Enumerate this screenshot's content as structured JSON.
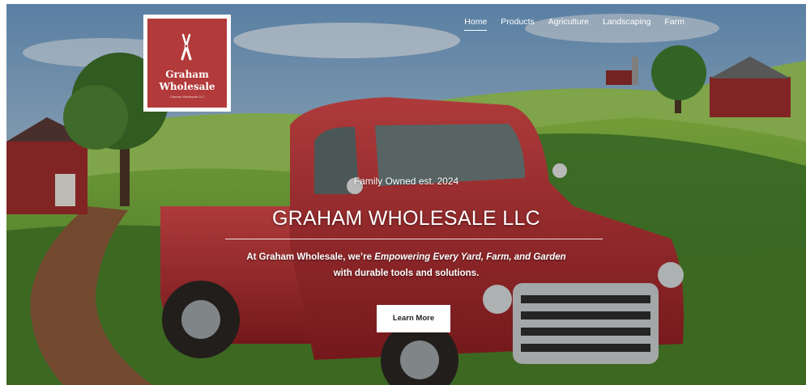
{
  "brand": {
    "name": "Graham Wholesale",
    "tagline": "Graham Wholesale LLC",
    "bg_color": "#b23a3a"
  },
  "nav": {
    "items": [
      "Home",
      "Products",
      "Agriculture",
      "Landscaping",
      "Farm"
    ],
    "active": "Home"
  },
  "hero": {
    "eyebrow": "Family Owned est. 2024",
    "title": "GRAHAM WHOLESALE LLC",
    "desc_prefix": "At Graham Wholesale, we’re ",
    "desc_emphasis": "Empowering Every Yard, Farm, and Garden",
    "desc_suffix": "with durable tools and solutions.",
    "cta": "Learn More",
    "background": "painted farm landscape with red vintage pickup truck"
  },
  "icons": {
    "logo_icon": "pruning-shears-icon"
  }
}
